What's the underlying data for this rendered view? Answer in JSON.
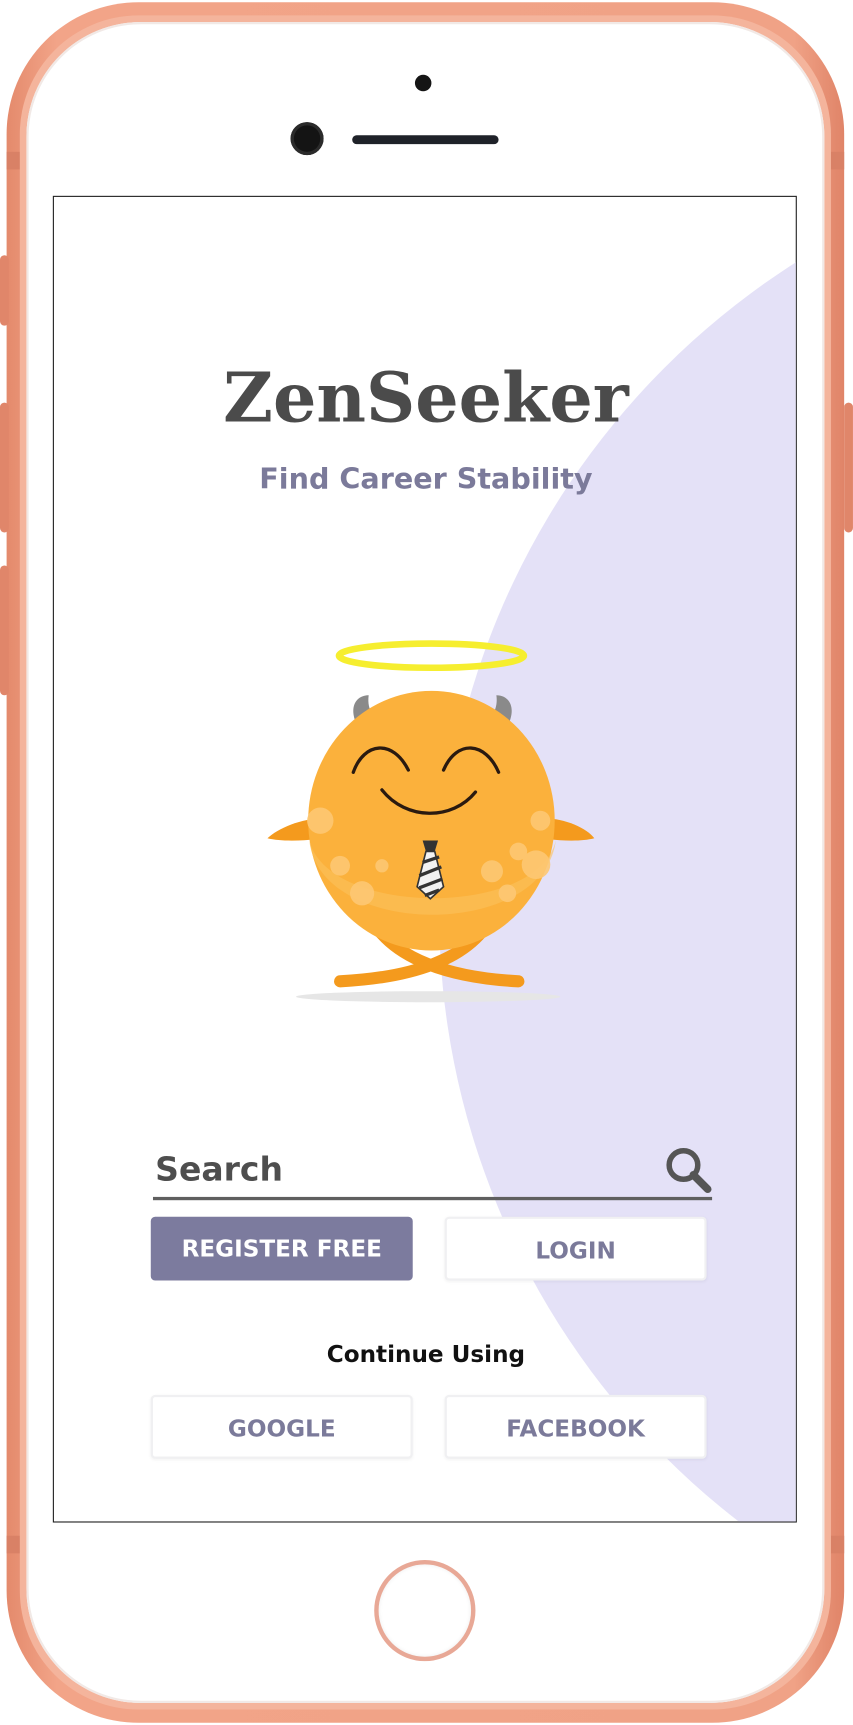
{
  "app": {
    "title": "ZenSeeker",
    "subtitle": "Find Career Stability"
  },
  "search": {
    "placeholder": "Search",
    "value": ""
  },
  "auth": {
    "register_label": "REGISTER FREE",
    "login_label": "LOGIN"
  },
  "social": {
    "heading": "Continue Using",
    "google_label": "GOOGLE",
    "facebook_label": "FACEBOOK"
  },
  "icons": {
    "search": "search-icon",
    "mascot": "mascot-illustration"
  },
  "colors": {
    "primary": "#7c7b9e",
    "background_arc": "#e4e1f7",
    "title": "#4b4b4b",
    "phone_frame": "#f0a286",
    "mascot_body": "#fbb13c",
    "halo": "#f6ee2f"
  }
}
